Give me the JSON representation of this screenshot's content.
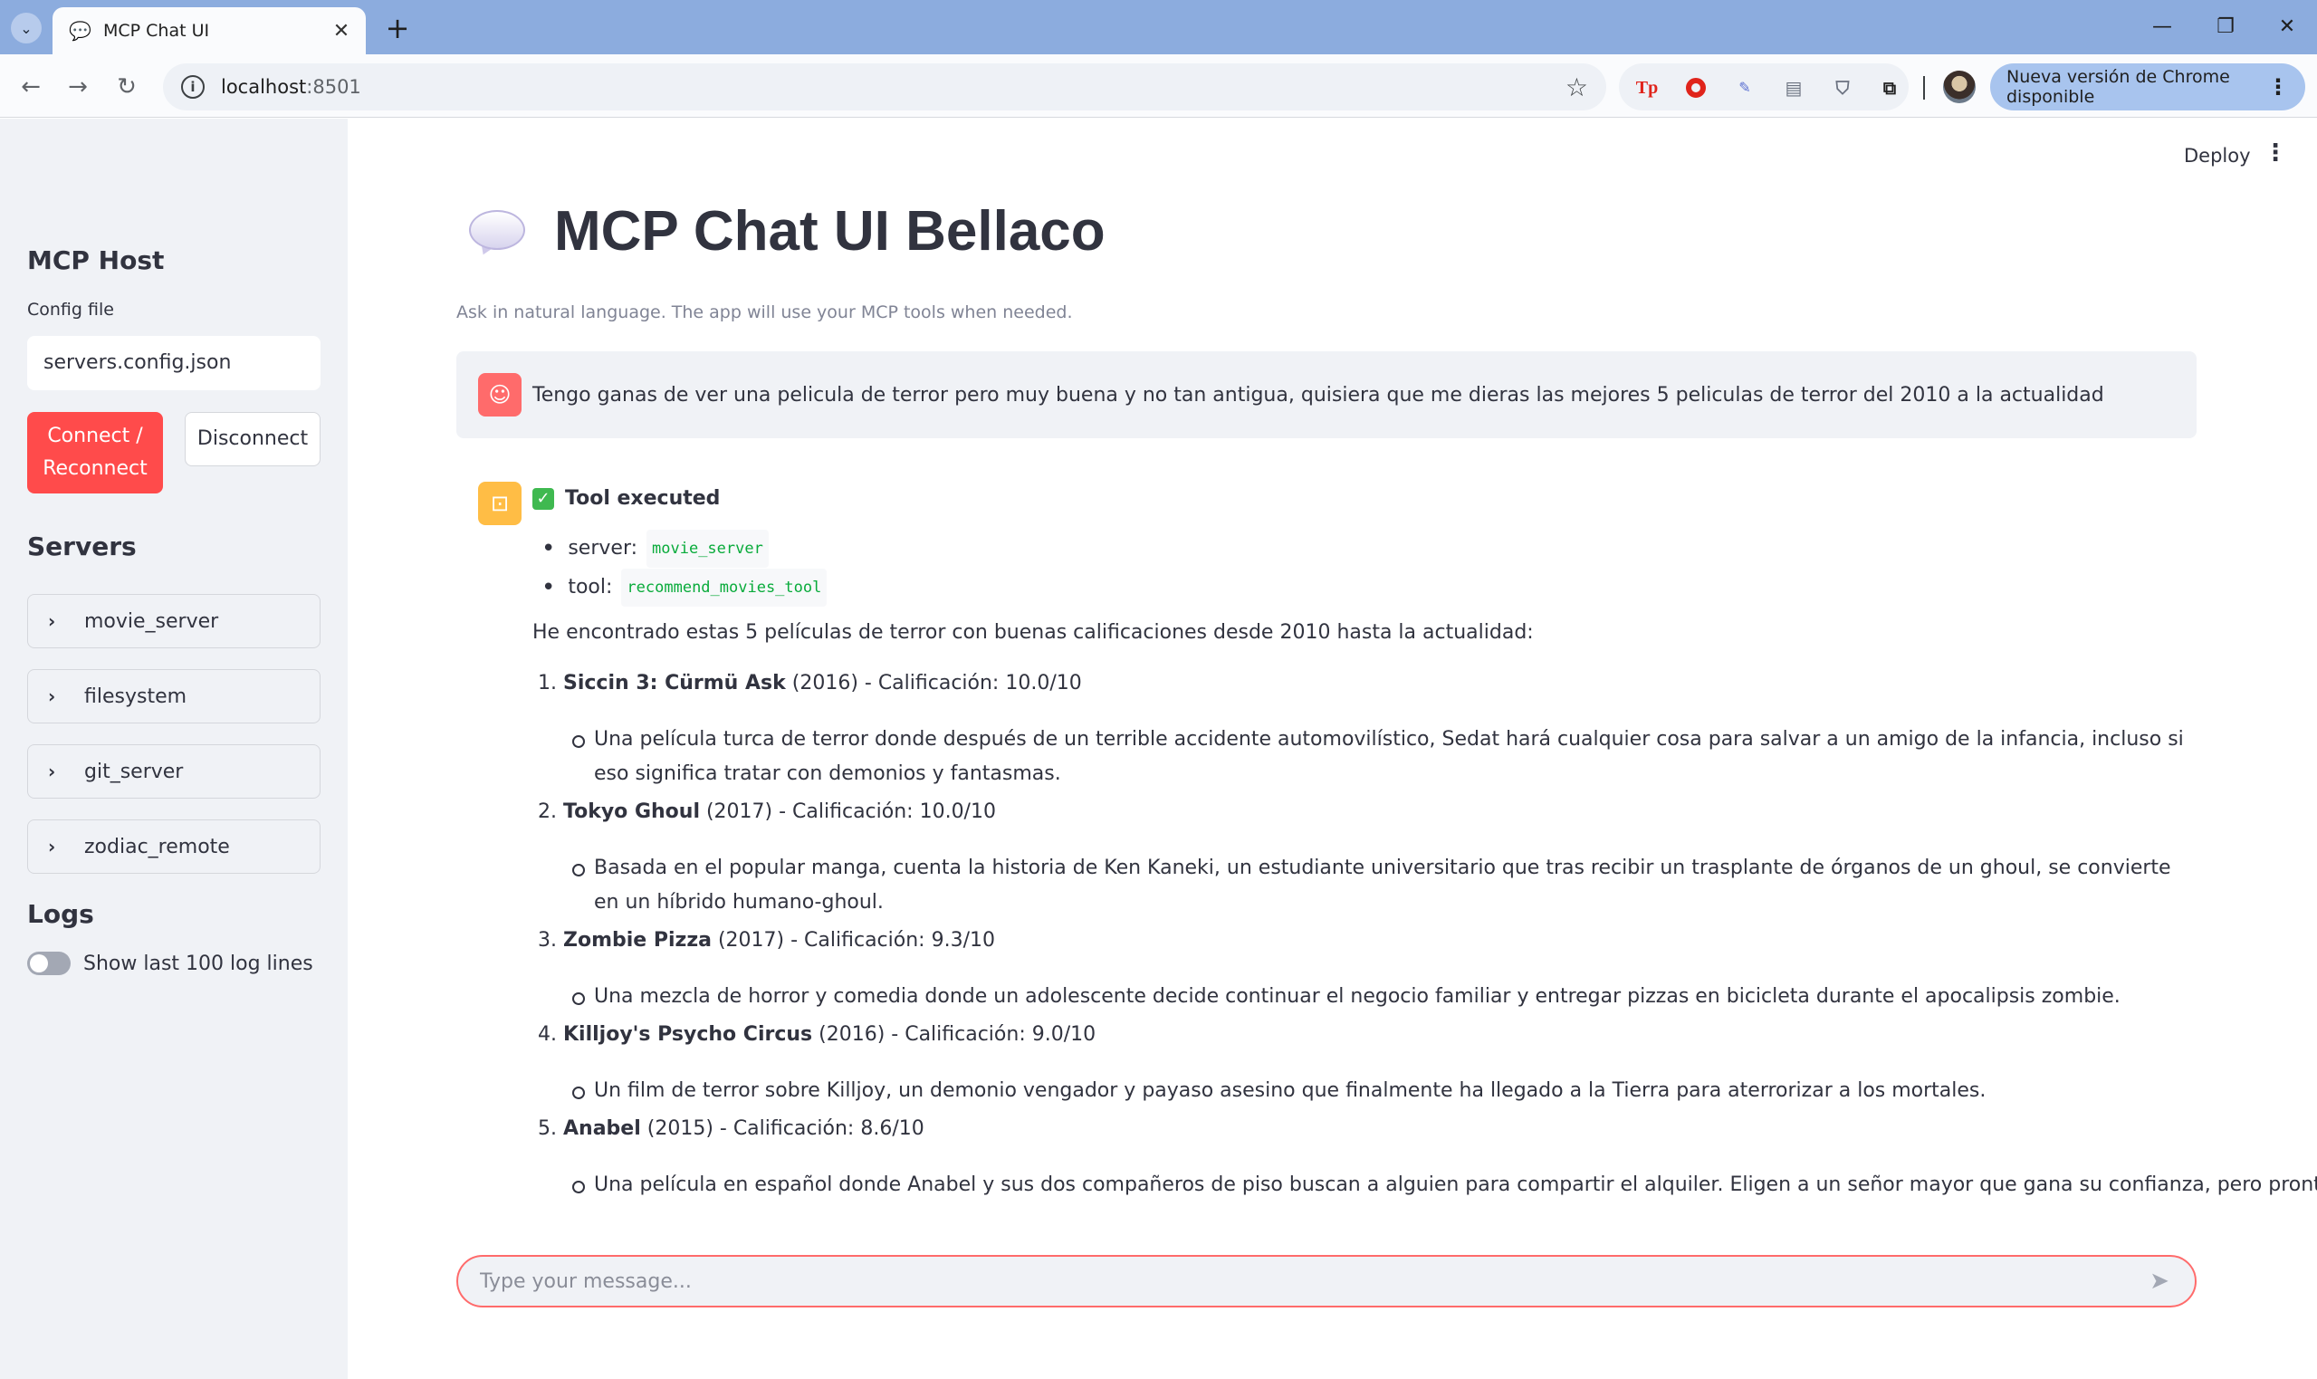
{
  "browser": {
    "tab_title": "MCP Chat UI",
    "url_host": "localhost",
    "url_port": ":8501",
    "update_label": "Nueva versión de Chrome disponible",
    "extensions": [
      "Tp",
      "opera-icon",
      "puzzle-art-icon",
      "page-icon",
      "shield-icon",
      "extensions-icon"
    ]
  },
  "sidebar": {
    "title": "MCP Host",
    "config_label": "Config file",
    "config_value": "servers.config.json",
    "connect_label": "Connect / Reconnect",
    "connect_line1": "Connect /",
    "connect_line2": "Reconnect",
    "disconnect_label": "Disconnect",
    "servers_title": "Servers",
    "servers": [
      "movie_server",
      "filesystem",
      "git_server",
      "zodiac_remote"
    ],
    "logs_title": "Logs",
    "logs_toggle_label": "Show last 100 log lines",
    "logs_toggle_on": false
  },
  "header": {
    "deploy_label": "Deploy"
  },
  "main": {
    "title": "MCP Chat UI Bellaco",
    "caption": "Ask in natural language. The app will use your MCP tools when needed.",
    "user_message": "Tengo ganas de ver una pelicula de terror pero muy buena y no tan antigua, quisiera que me dieras las mejores 5 peliculas de terror del 2010 a la actualidad",
    "tool_status": "Tool executed",
    "tool_server_label": "server:",
    "tool_server_value": "movie_server",
    "tool_name_label": "tool:",
    "tool_name_value": "recommend_movies_tool",
    "intro": "He encontrado estas 5 películas de terror con buenas calificaciones desde 2010 hasta la actualidad:",
    "movies": [
      {
        "num": "1.",
        "title": "Siccin 3: Cürmü Ask",
        "meta": " (2016) - Calificación: 10.0/10",
        "desc": "Una película turca de terror donde después de un terrible accidente automovilístico, Sedat hará cualquier cosa para salvar a un amigo de la infancia, incluso si eso significa tratar con demonios y fantasmas."
      },
      {
        "num": "2.",
        "title": "Tokyo Ghoul",
        "meta": " (2017) - Calificación: 10.0/10",
        "desc": "Basada en el popular manga, cuenta la historia de Ken Kaneki, un estudiante universitario que tras recibir un trasplante de órganos de un ghoul, se convierte en un híbrido humano-ghoul."
      },
      {
        "num": "3.",
        "title": "Zombie Pizza",
        "meta": " (2017) - Calificación: 9.3/10",
        "desc": "Una mezcla de horror y comedia donde un adolescente decide continuar el negocio familiar y entregar pizzas en bicicleta durante el apocalipsis zombie."
      },
      {
        "num": "4.",
        "title": "Killjoy's Psycho Circus",
        "meta": " (2016) - Calificación: 9.0/10",
        "desc": "Un film de terror sobre Killjoy, un demonio vengador y payaso asesino que finalmente ha llegado a la Tierra para aterrorizar a los mortales."
      },
      {
        "num": "5.",
        "title": "Anabel",
        "meta": " (2015) - Calificación: 8.6/10",
        "desc": "Una película en español donde Anabel y sus dos compañeros de piso buscan a alguien para compartir el alquiler. Eligen a un señor mayor que gana su confianza, pero pronto"
      }
    ],
    "input_placeholder": "Type your message..."
  },
  "colors": {
    "primary": "#ff4b4b",
    "sidebar_bg": "#f0f2f6",
    "user_avatar": "#ff6b6b",
    "bot_avatar": "#ffbd45",
    "code_text": "#09ab3b",
    "chrome_tabbar": "#8cacde"
  }
}
